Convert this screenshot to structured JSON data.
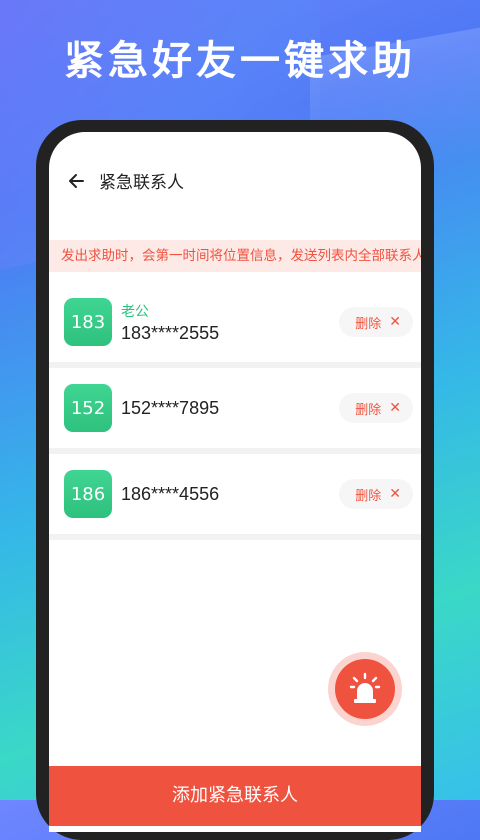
{
  "banner": {
    "title": "紧急好友一键求助"
  },
  "header": {
    "title": "紧急联系人"
  },
  "notice": {
    "text": "发出求助时，会第一时间将位置信息，发送列表内全部联系人"
  },
  "contacts": [
    {
      "avatar": "183",
      "name": "老公",
      "phone": "183****2555",
      "delete_label": "删除"
    },
    {
      "avatar": "152",
      "name": "",
      "phone": "152****7895",
      "delete_label": "删除"
    },
    {
      "avatar": "186",
      "name": "",
      "phone": "186****4556",
      "delete_label": "删除"
    }
  ],
  "icons": {
    "back": "arrow-left-icon",
    "delete": "close-icon",
    "sos": "alarm-siren-icon"
  },
  "colors": {
    "accent": "#f05240",
    "avatar_green": "#2fc17e"
  },
  "footer": {
    "add_button_label": "添加紧急联系人"
  }
}
